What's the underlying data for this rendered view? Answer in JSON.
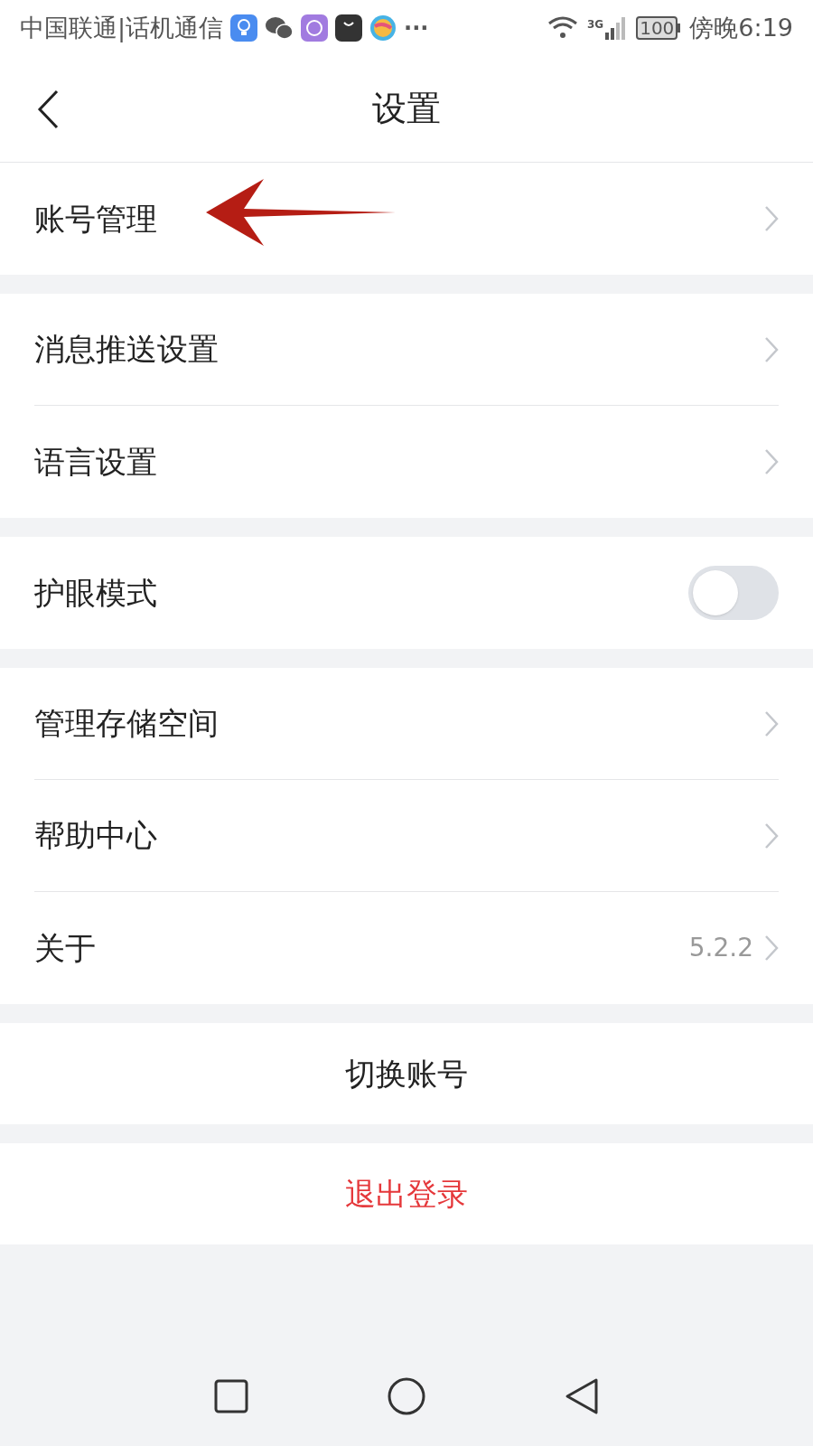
{
  "status_bar": {
    "carrier": "中国联通|话机通信",
    "more": "···",
    "network": "3G",
    "battery": "100",
    "time": "傍晚6:19"
  },
  "header": {
    "title": "设置"
  },
  "groups": [
    {
      "items": [
        {
          "kind": "link",
          "label": "账号管理"
        }
      ]
    },
    {
      "items": [
        {
          "kind": "link",
          "label": "消息推送设置"
        },
        {
          "kind": "link",
          "label": "语言设置"
        }
      ]
    },
    {
      "items": [
        {
          "kind": "toggle",
          "label": "护眼模式",
          "on": false
        }
      ]
    },
    {
      "items": [
        {
          "kind": "link",
          "label": "管理存储空间"
        },
        {
          "kind": "link",
          "label": "帮助中心"
        },
        {
          "kind": "link",
          "label": "关于",
          "value": "5.2.2"
        }
      ]
    }
  ],
  "buttons": [
    {
      "kind": "normal",
      "label": "切换账号"
    },
    {
      "kind": "danger",
      "label": "退出登录"
    }
  ]
}
